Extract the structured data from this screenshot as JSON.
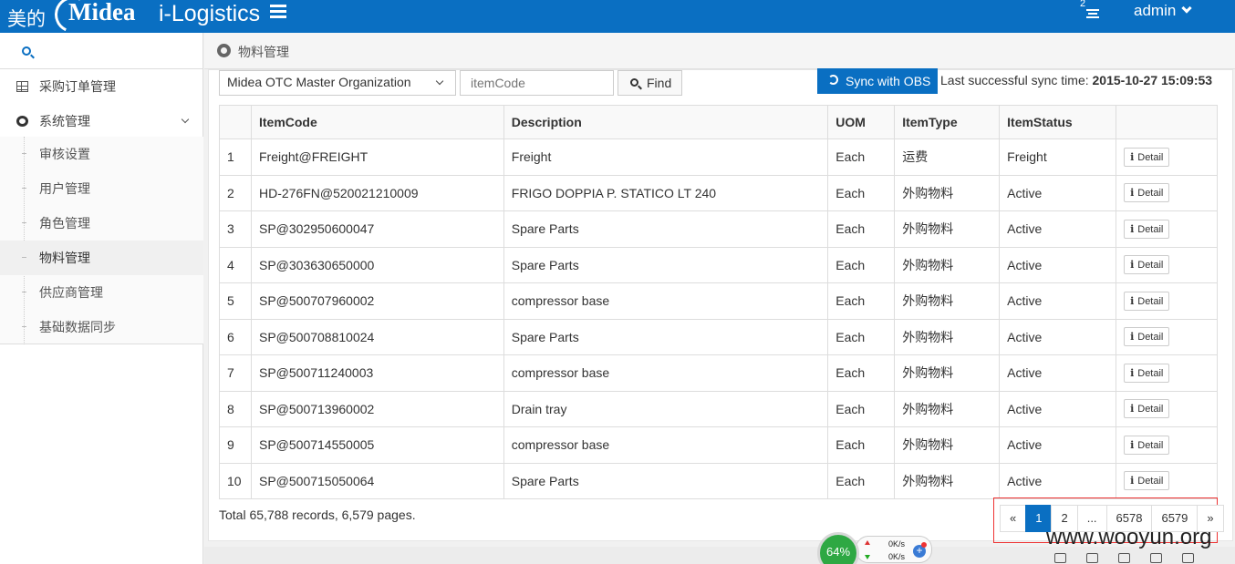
{
  "header": {
    "brand_cn": "美的",
    "brand_logo": "Midea",
    "app_title": "i-Logistics",
    "notification_count": "2",
    "user": "admin"
  },
  "sidebar": {
    "items": [
      {
        "label": "采购订单管理",
        "icon": "grid-icon"
      },
      {
        "label": "系统管理",
        "icon": "gear-icon"
      }
    ],
    "sub_items": [
      {
        "label": "审核设置"
      },
      {
        "label": "用户管理"
      },
      {
        "label": "角色管理"
      },
      {
        "label": "物料管理"
      },
      {
        "label": "供应商管理"
      },
      {
        "label": "基础数据同步"
      }
    ]
  },
  "breadcrumb": {
    "title": "物料管理"
  },
  "filters": {
    "organization": "Midea OTC Master Organization",
    "item_code_placeholder": "itemCode",
    "find_label": "Find",
    "sync_label": "Sync with OBS",
    "sync_prefix": "Last successful sync time: ",
    "sync_time": "2015-10-27 15:09:53"
  },
  "table": {
    "columns": [
      "",
      "ItemCode",
      "Description",
      "UOM",
      "ItemType",
      "ItemStatus",
      ""
    ],
    "detail_label": "Detail",
    "rows": [
      {
        "no": "1",
        "code": "Freight@FREIGHT",
        "desc": "Freight",
        "uom": "Each",
        "type": "运费",
        "status": "Freight"
      },
      {
        "no": "2",
        "code": "HD-276FN@520021210009",
        "desc": "FRIGO DOPPIA P. STATICO LT 240",
        "uom": "Each",
        "type": "外购物料",
        "status": "Active"
      },
      {
        "no": "3",
        "code": "SP@302950600047",
        "desc": "Spare Parts",
        "uom": "Each",
        "type": "外购物料",
        "status": "Active"
      },
      {
        "no": "4",
        "code": "SP@303630650000",
        "desc": "Spare Parts",
        "uom": "Each",
        "type": "外购物料",
        "status": "Active"
      },
      {
        "no": "5",
        "code": "SP@500707960002",
        "desc": "compressor base",
        "uom": "Each",
        "type": "外购物料",
        "status": "Active"
      },
      {
        "no": "6",
        "code": "SP@500708810024",
        "desc": "Spare Parts",
        "uom": "Each",
        "type": "外购物料",
        "status": "Active"
      },
      {
        "no": "7",
        "code": "SP@500711240003",
        "desc": "compressor base",
        "uom": "Each",
        "type": "外购物料",
        "status": "Active"
      },
      {
        "no": "8",
        "code": "SP@500713960002",
        "desc": "Drain tray",
        "uom": "Each",
        "type": "外购物料",
        "status": "Active"
      },
      {
        "no": "9",
        "code": "SP@500714550005",
        "desc": "compressor base",
        "uom": "Each",
        "type": "外购物料",
        "status": "Active"
      },
      {
        "no": "10",
        "code": "SP@500715050064",
        "desc": "Spare Parts",
        "uom": "Each",
        "type": "外购物料",
        "status": "Active"
      }
    ]
  },
  "footer": {
    "total": "Total 65,788 records, 6,579 pages.",
    "pages": [
      "«",
      "1",
      "2",
      "...",
      "6578",
      "6579",
      "»"
    ],
    "active_page": "1"
  },
  "overlay": {
    "cpu": "64%",
    "up_speed": "0K/s",
    "down_speed": "0K/s",
    "watermark": "www.wooyun.org"
  },
  "colors": {
    "primary": "#0a6fc2",
    "highlight": "#e33333"
  }
}
